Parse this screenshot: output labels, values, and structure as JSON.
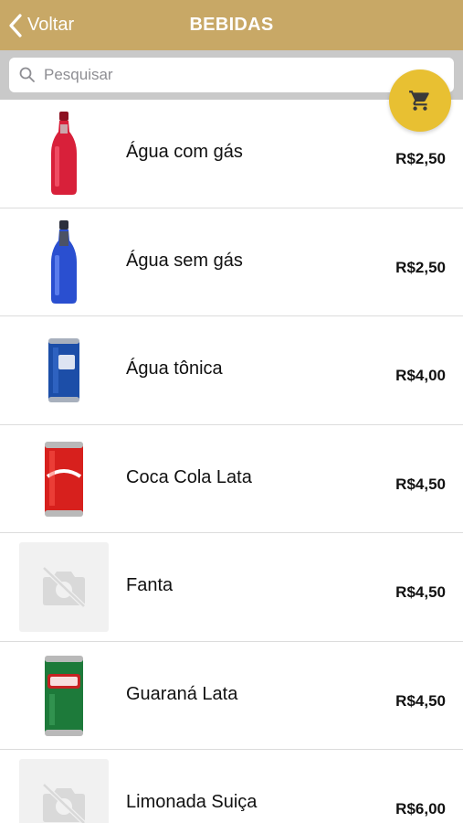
{
  "header": {
    "back_label": "Voltar",
    "title": "BEBIDAS",
    "background": "#c8a866"
  },
  "search": {
    "placeholder": "Pesquisar"
  },
  "cart": {
    "icon": "shopping-cart-icon",
    "color": "#e8c032"
  },
  "products": [
    {
      "name": "Água com gás",
      "price": "R$2,50",
      "image": "red-glass-bottle"
    },
    {
      "name": "Água sem gás",
      "price": "R$2,50",
      "image": "blue-glass-bottle"
    },
    {
      "name": "Água tônica",
      "price": "R$4,00",
      "image": "blue-can"
    },
    {
      "name": "Coca Cola Lata",
      "price": "R$4,50",
      "image": "red-can"
    },
    {
      "name": "Fanta",
      "price": "R$4,50",
      "image": "no-photo-placeholder"
    },
    {
      "name": "Guaraná Lata",
      "price": "R$4,50",
      "image": "green-can"
    },
    {
      "name": "Limonada Suiça",
      "price": "R$6,00",
      "image": "no-photo-placeholder"
    }
  ]
}
